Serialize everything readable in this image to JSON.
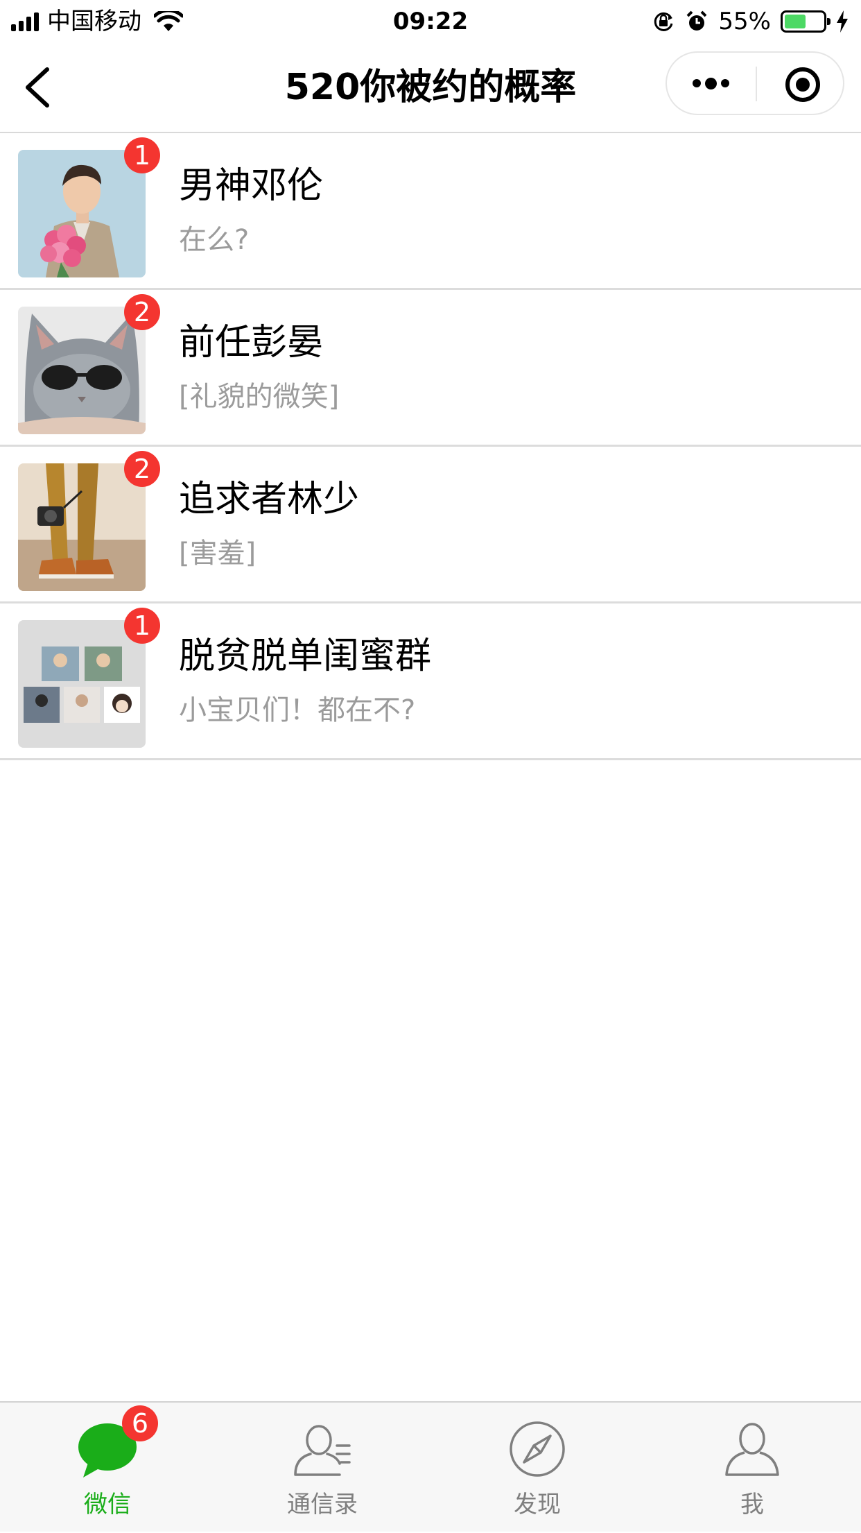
{
  "status_bar": {
    "carrier": "中国移动",
    "time": "09:22",
    "battery_percent": "55%",
    "battery_level": 0.55,
    "battery_color": "#4cd964",
    "icons": [
      "signal-icon",
      "wifi-icon",
      "orientation-lock-icon",
      "alarm-icon",
      "battery-icon",
      "charging-icon"
    ]
  },
  "nav": {
    "title": "520你被约的概率",
    "back_icon": "chevron-left-icon",
    "more_icon": "more-dots-icon",
    "close_icon": "target-circle-icon"
  },
  "chats": [
    {
      "name": "男神邓伦",
      "preview": "在么?",
      "badge": "1",
      "avatar": "man-with-roses-photo"
    },
    {
      "name": "前任彭晏",
      "preview": "[礼貌的微笑]",
      "badge": "2",
      "avatar": "cat-with-sunglasses-photo"
    },
    {
      "name": "追求者林少",
      "preview": "[害羞]",
      "badge": "2",
      "avatar": "legs-with-camera-photo"
    },
    {
      "name": "脱贫脱单闺蜜群",
      "preview": "小宝贝们！都在不?",
      "badge": "1",
      "avatar": "group-collage-photo"
    }
  ],
  "tabbar": {
    "active_color": "#1aad19",
    "badge_color": "#f43530",
    "tabs": [
      {
        "label": "微信",
        "icon": "chat-bubble-icon",
        "badge": "6",
        "active": true
      },
      {
        "label": "通信录",
        "icon": "contacts-icon",
        "active": false
      },
      {
        "label": "发现",
        "icon": "compass-icon",
        "active": false
      },
      {
        "label": "我",
        "icon": "person-icon",
        "active": false
      }
    ]
  }
}
